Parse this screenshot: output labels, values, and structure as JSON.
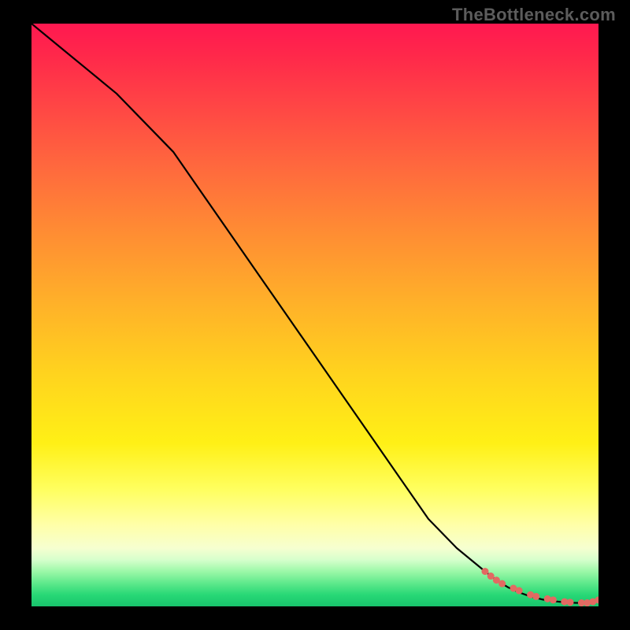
{
  "watermark": "TheBottleneck.com",
  "chart_data": {
    "type": "line",
    "title": "",
    "xlabel": "",
    "ylabel": "",
    "xlim": [
      0,
      100
    ],
    "ylim": [
      0,
      100
    ],
    "grid": false,
    "legend": "none",
    "annotations": [],
    "series": [
      {
        "name": "curve",
        "style": "line",
        "color": "#000000",
        "x": [
          0,
          5,
          10,
          15,
          20,
          25,
          30,
          35,
          40,
          45,
          50,
          55,
          60,
          65,
          70,
          75,
          80,
          82,
          84,
          86,
          88,
          90,
          92,
          94,
          96,
          98,
          100
        ],
        "y": [
          100,
          96,
          92,
          88,
          83,
          78,
          71,
          64,
          57,
          50,
          43,
          36,
          29,
          22,
          15,
          10,
          6,
          4.5,
          3.3,
          2.4,
          1.7,
          1.2,
          0.9,
          0.7,
          0.6,
          0.6,
          1.1
        ]
      },
      {
        "name": "markers",
        "style": "scatter",
        "color": "#e26a62",
        "x": [
          80,
          81,
          82,
          83,
          85,
          86,
          88,
          89,
          91,
          92,
          94,
          95,
          97,
          98,
          99,
          100
        ],
        "y": [
          6.0,
          5.2,
          4.5,
          3.9,
          3.1,
          2.7,
          2.0,
          1.7,
          1.3,
          1.1,
          0.8,
          0.7,
          0.6,
          0.6,
          0.8,
          1.1
        ]
      }
    ]
  }
}
